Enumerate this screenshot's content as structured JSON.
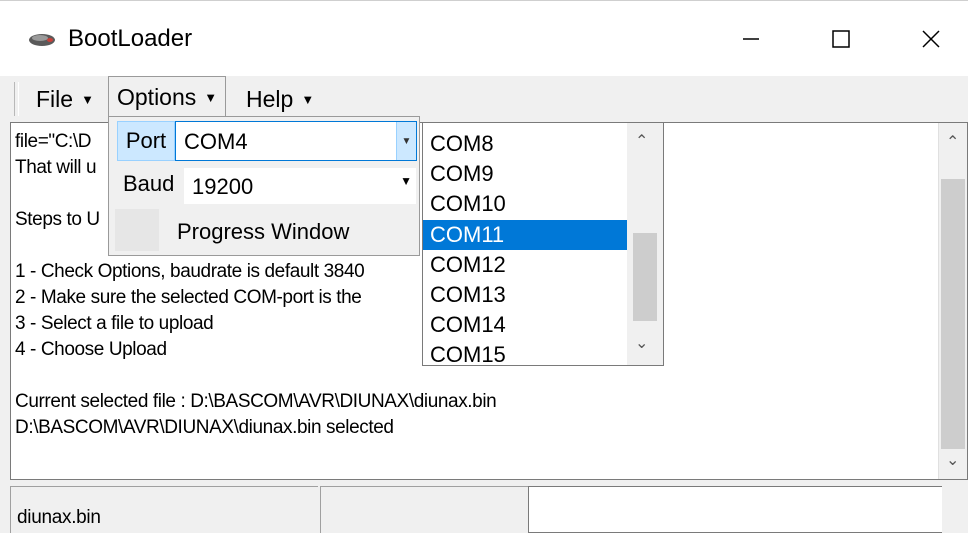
{
  "window": {
    "title": "BootLoader",
    "icon": "bootloader-app-icon"
  },
  "controls": {
    "minimize": "—",
    "maximize": "☐",
    "close": "✕"
  },
  "menu": {
    "items": [
      {
        "label": "File",
        "caret": "▼"
      },
      {
        "label": "Options",
        "caret": "▼"
      },
      {
        "label": "Help",
        "caret": "▼"
      }
    ],
    "overflow": "⌄"
  },
  "log": {
    "lines": [
      "file=\"C:\\D",
      "That will u",
      "",
      "Steps to U",
      "",
      "1 - Check Options, baudrate is default 3840",
      "2 - Make sure the selected COM-port is the",
      "3 - Select a file to upload",
      "4 - Choose Upload",
      "",
      "Current selected file : D:\\BASCOM\\AVR\\DIUNAX\\diunax.bin",
      "D:\\BASCOM\\AVR\\DIUNAX\\diunax.bin selected"
    ]
  },
  "options_panel": {
    "port_label": "Port",
    "port_value": "COM4",
    "baud_label": "Baud",
    "baud_value": "19200",
    "progress_window": "Progress Window"
  },
  "com_list": {
    "items": [
      "COM8",
      "COM9",
      "COM10",
      "COM11",
      "COM12",
      "COM13",
      "COM14",
      "COM15"
    ],
    "selected": "COM11"
  },
  "status": {
    "file": "diunax.bin"
  },
  "colors": {
    "selection": "#0078d7",
    "highlight": "#cce8ff"
  }
}
